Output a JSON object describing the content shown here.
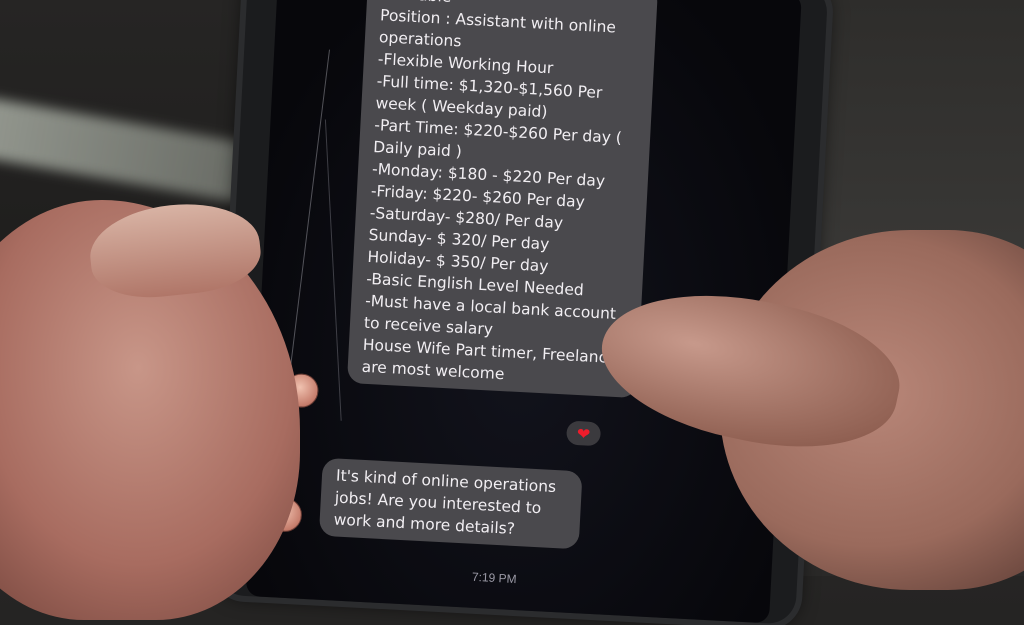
{
  "scene": {
    "description": "Photo of a hand-held smartphone with a cracked screen showing a chat conversation"
  },
  "chat": {
    "messages": [
      {
        "sender": "contact",
        "text": "Available\nPosition : Assistant with online operations\n-Flexible Working Hour\n-Full time: $1,320-$1,560 Per week ( Weekday paid)\n-Part Time: $220-$260 Per day ( Daily paid )\n-Monday: $180 - $220 Per day\n-Friday: $220- $260 Per day\n-Saturday- $280/ Per day\nSunday- $ 320/ Per day\nHoliday- $ 350/ Per day\n-Basic English Level Needed\n-Must have a local bank account to receive salary\nHouse Wife Part timer, Freelancer are most welcome",
        "reaction": "❤"
      },
      {
        "sender": "contact",
        "text": "It's kind of online operations jobs! Are you interested to work and more details?"
      }
    ],
    "timestamp": "7:19 PM"
  },
  "colors": {
    "bubble": "#4a494d",
    "bubble_text": "#f1eef2",
    "reaction_heart": "#ee1c2b",
    "screen_bg": "#07070b"
  }
}
